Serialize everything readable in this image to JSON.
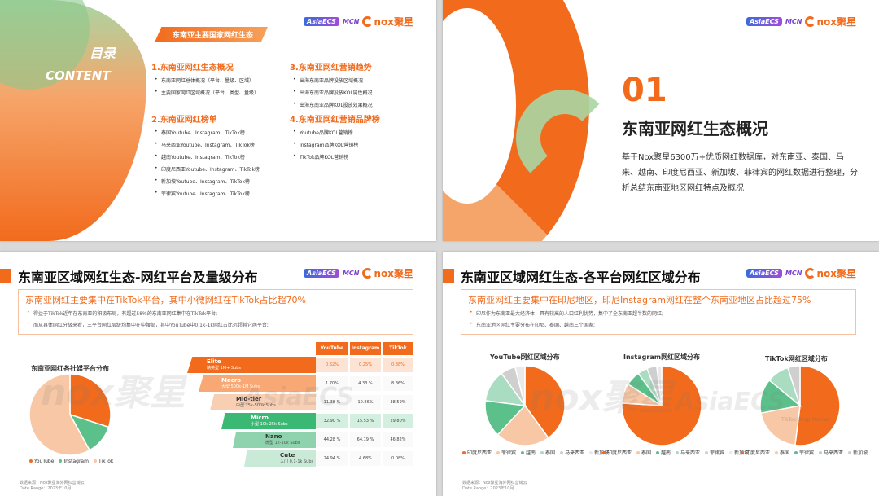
{
  "logos": {
    "asia": "AsiaECS",
    "mcn": "MCN",
    "nox": "nox聚星"
  },
  "slide1": {
    "title": "目录",
    "subtitle": "CONTENT",
    "tag": "东南亚主要国家网红生态",
    "sections": [
      {
        "heading": "1.东南亚网红生态概况",
        "items": [
          "东南亚网红总体概况（平台、量级、区域）",
          "主要国家网红区域概况（平台、类型、量级）"
        ]
      },
      {
        "heading": "2.东南亚网红榜单",
        "items": [
          "泰国Youtube、Instagram、TikTok榜",
          "马来西亚Youtube、Instagram、TikTok榜",
          "越南Youtube、Instagram、TikTok榜",
          "印度尼西亚Youtube、Instagram、TikTok榜",
          "新加坡Youtube、Instagram、TikTok榜",
          "菲律宾Youtube、Instagram、TikTok榜"
        ]
      },
      {
        "heading": "3.东南亚网红营销趋势",
        "items": [
          "出海东南亚品牌投放区域概况",
          "出海东南亚品牌投放KOL属性概况",
          "出海东南亚品牌KOL投放效果概况"
        ]
      },
      {
        "heading": "4.东南亚网红营销品牌榜",
        "items": [
          "Youtube品牌KOL营销榜",
          "Instagram品牌KOL营销榜",
          "TikTok品牌KOL营销榜"
        ]
      }
    ]
  },
  "slide2": {
    "number": "01",
    "title": "东南亚网红生态概况",
    "desc": "基于Nox聚星6300万+优质网红数据库，对东南亚、泰国、马来、越南、印度尼西亚、新加坡、菲律宾的网红数据进行整理，分析总结东南亚地区网红特点及概况"
  },
  "slide3": {
    "title": "东南亚区域网红生态-网红平台及量级分布",
    "summary": "东南亚网红主要集中在TikTok平台，其中小微网红在TikTok占比超70%",
    "points": [
      "得益于TikTok近年在东南亚的积极布局，有超过58%的东南亚网红集中在TikTok平台;",
      "而从具体网红分级来看，三平台网红层级均集中在中腰部，其中YouTube中0.1k-1k网红占比远超其它两平台;"
    ],
    "pie_title": "东南亚网红各社媒平台分布",
    "legend": [
      "YouTube",
      "Instagram",
      "TikTok"
    ],
    "tiers": [
      {
        "name": "Elite",
        "sub": "精英型 1M+ Subs"
      },
      {
        "name": "Macro",
        "sub": "大型 500k-1M Subs"
      },
      {
        "name": "Mid-tier",
        "sub": "中型 25k-500k Subs"
      },
      {
        "name": "Micro",
        "sub": "小型 10k-25k Subs"
      },
      {
        "name": "Nano",
        "sub": "微型 1k-10k Subs"
      },
      {
        "name": "Cute",
        "sub": "入门 0.1-1k Subs"
      }
    ],
    "table_headers": [
      "YouTube",
      "Instagram",
      "TikTok"
    ],
    "table_rows": [
      [
        "0.62%",
        "0.25%",
        "0.38%"
      ],
      [
        "1.70%",
        "4.33 %",
        "8.36%"
      ],
      [
        "11.38 %",
        "10.86%",
        "38.59%"
      ],
      [
        "32.90 %",
        "15.53 %",
        "29.80%"
      ],
      [
        "44.28 %",
        "64.19 %",
        "46.82%"
      ],
      [
        "24.94 %",
        "4.68%",
        "0.08%"
      ]
    ],
    "footer": [
      "数据来源：Nox聚星海外网红营销云",
      "Date Range：2023年10月"
    ]
  },
  "slide4": {
    "title": "东南亚区域网红生态-各平台网红区域分布",
    "summary": "东南亚网红主要集中在印尼地区，印尼Instagram网红在整个东南亚地区占比超过75%",
    "points": [
      "印尼作为东南亚最大经济体，具有较高的人口红利优势，集中了全东南亚超半数的网红;",
      "东南亚地区网红主要分布在印尼、泰国、越南三个国家;"
    ],
    "charts": [
      {
        "title": "YouTube网红区域分布",
        "legend": [
          "印度尼西亚",
          "菲律宾",
          "越南",
          "泰国",
          "马来西亚",
          "新加坡"
        ]
      },
      {
        "title": "Instagram网红区域分布",
        "legend": [
          "印度尼西亚",
          "泰国",
          "越南",
          "马来西亚",
          "菲律宾",
          "新加坡"
        ]
      },
      {
        "title": "TikTok网红区域分布",
        "legend": [
          "印度尼西亚",
          "泰国",
          "菲律宾",
          "马来西亚",
          "新加坡"
        ]
      }
    ],
    "footer": [
      "数据来源：Nox聚星海外网红营销云",
      "Date Range：2023年10月"
    ],
    "watermark_sub": "TikTok Shop Partner"
  },
  "colors": {
    "orange": "#f26b1d",
    "peach": "#f8c7a6",
    "green": "#5cc08a",
    "lightgreen": "#a9dcc0",
    "gray": "#cfcfcf"
  },
  "chart_data": [
    {
      "type": "pie",
      "categories": [
        "YouTube",
        "Instagram",
        "TikTok"
      ],
      "values": [
        30,
        12,
        58
      ],
      "title": "东南亚网红各社媒平台分布"
    },
    {
      "type": "table",
      "categories": [
        "Elite",
        "Macro",
        "Mid-tier",
        "Micro",
        "Nano",
        "Cute"
      ],
      "series": [
        {
          "name": "YouTube",
          "values": [
            0.62,
            1.7,
            11.38,
            32.9,
            44.28,
            24.94
          ]
        },
        {
          "name": "Instagram",
          "values": [
            0.25,
            4.33,
            10.86,
            15.53,
            64.19,
            4.68
          ]
        },
        {
          "name": "TikTok",
          "values": [
            0.38,
            8.36,
            38.59,
            29.8,
            46.82,
            0.08
          ]
        }
      ]
    },
    {
      "type": "pie",
      "title": "YouTube网红区域分布",
      "categories": [
        "印度尼西亚",
        "菲律宾",
        "越南",
        "泰国",
        "马来西亚",
        "新加坡"
      ],
      "values": [
        40,
        22,
        15,
        13,
        6,
        4
      ]
    },
    {
      "type": "pie",
      "title": "Instagram网红区域分布",
      "categories": [
        "印度尼西亚",
        "泰国",
        "越南",
        "马来西亚",
        "菲律宾",
        "新加坡"
      ],
      "values": [
        76,
        8,
        6,
        4,
        4,
        2
      ]
    },
    {
      "type": "pie",
      "title": "TikTok网红区域分布",
      "categories": [
        "印度尼西亚",
        "泰国",
        "菲律宾",
        "马来西亚",
        "新加坡"
      ],
      "values": [
        52,
        20,
        14,
        9,
        5
      ]
    }
  ]
}
